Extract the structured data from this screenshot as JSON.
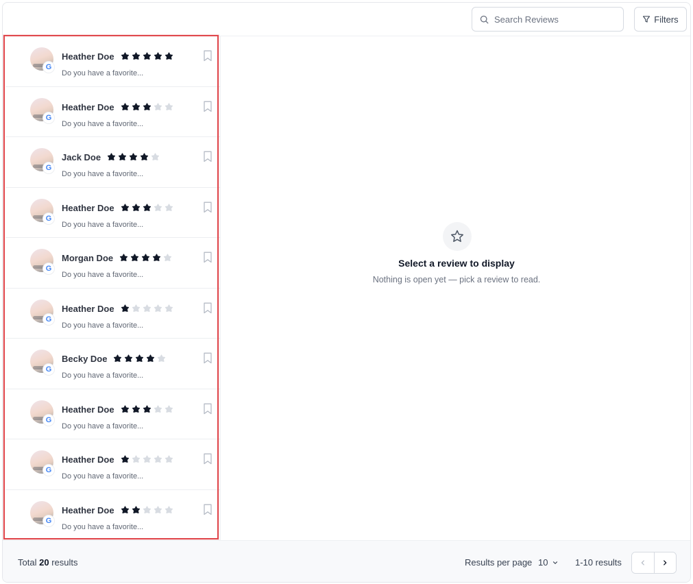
{
  "toolbar": {
    "search_placeholder": "Search Reviews",
    "filters_label": "Filters"
  },
  "reviews": [
    {
      "name": "Heather Doe",
      "rating": 5,
      "snippet": "Do you have a favorite...",
      "source_icon": "google-icon"
    },
    {
      "name": "Heather Doe",
      "rating": 3,
      "snippet": "Do you have a favorite...",
      "source_icon": "google-icon"
    },
    {
      "name": "Jack Doe",
      "rating": 4,
      "snippet": "Do you have a favorite...",
      "source_icon": "google-icon"
    },
    {
      "name": "Heather Doe",
      "rating": 3,
      "snippet": "Do you have a favorite...",
      "source_icon": "google-icon"
    },
    {
      "name": "Morgan Doe",
      "rating": 4,
      "snippet": "Do you have a favorite...",
      "source_icon": "google-icon"
    },
    {
      "name": "Heather Doe",
      "rating": 1,
      "snippet": "Do you have a favorite...",
      "source_icon": "google-icon"
    },
    {
      "name": "Becky Doe",
      "rating": 4,
      "snippet": "Do you have a favorite...",
      "source_icon": "google-icon"
    },
    {
      "name": "Heather Doe",
      "rating": 3,
      "snippet": "Do you have a favorite...",
      "source_icon": "google-icon"
    },
    {
      "name": "Heather Doe",
      "rating": 1,
      "snippet": "Do you have a favorite...",
      "source_icon": "google-icon"
    },
    {
      "name": "Heather Doe",
      "rating": 2,
      "snippet": "Do you have a favorite...",
      "source_icon": "google-icon"
    }
  ],
  "empty_state": {
    "icon": "star-outline-icon",
    "title": "Select a review to display",
    "subtitle": "Nothing is open yet — pick a review to read."
  },
  "footer": {
    "total_prefix": "Total",
    "total_count": "20",
    "total_suffix": "results",
    "per_page_label": "Results per page",
    "per_page_value": "10",
    "range_label": "1-10 results"
  },
  "colors": {
    "star_filled": "#111827",
    "star_empty": "#d8dce2",
    "highlight_border": "#e0474c"
  }
}
